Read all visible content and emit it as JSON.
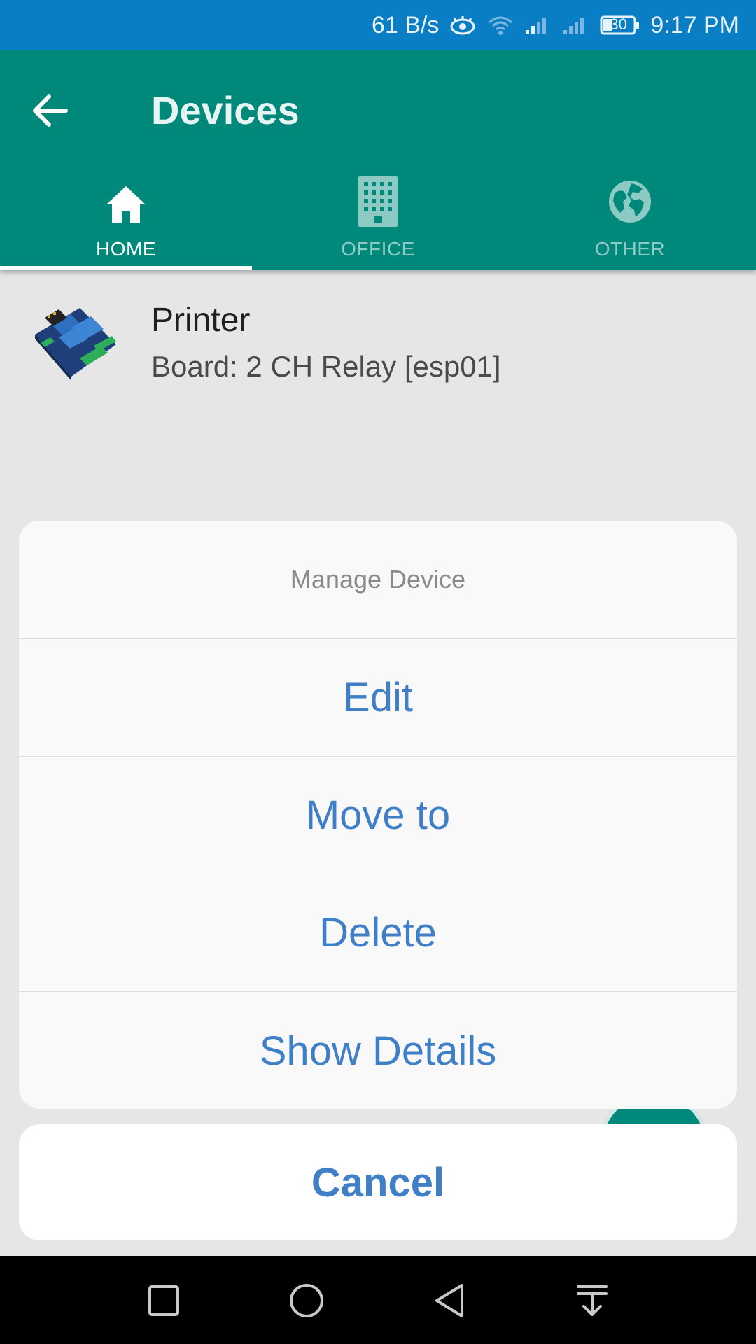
{
  "status_bar": {
    "net_speed": "61 B/s",
    "battery": "30",
    "time": "9:17 PM",
    "icons": [
      "eye-comfort-icon",
      "wifi-icon",
      "signal-icon",
      "signal-2-icon",
      "battery-icon"
    ]
  },
  "app_bar": {
    "title": "Devices",
    "back_icon": "arrow-back-icon"
  },
  "tabs": [
    {
      "label": "HOME",
      "icon": "home-icon",
      "active": true
    },
    {
      "label": "OFFICE",
      "icon": "office-building-icon",
      "active": false
    },
    {
      "label": "OTHER",
      "icon": "globe-icon",
      "active": false
    }
  ],
  "device": {
    "name": "Printer",
    "board": "Board: 2 CH Relay [esp01]",
    "thumbnail": "relay-board-image"
  },
  "sheet": {
    "title": "Manage Device",
    "items": [
      "Edit",
      "Move to",
      "Delete",
      "Show Details"
    ],
    "cancel": "Cancel"
  },
  "colors": {
    "status_bar": "#0a7ec5",
    "app_bar": "#00897b",
    "action_text": "#3f7fc7"
  }
}
